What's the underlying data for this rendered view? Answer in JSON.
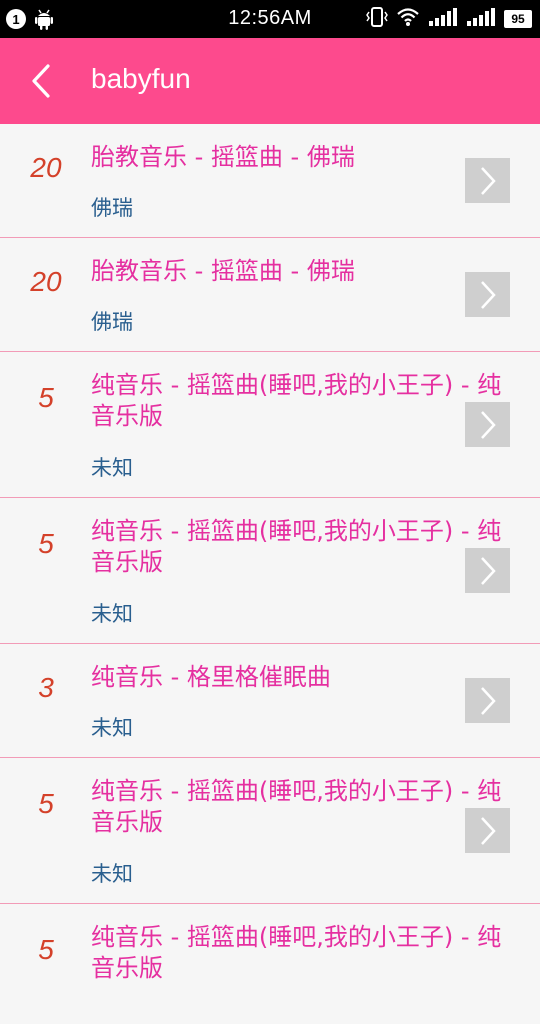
{
  "status_bar": {
    "notification_count": "1",
    "time": "12:56AM",
    "battery": "95"
  },
  "header": {
    "title": "babyfun"
  },
  "colors": {
    "accent": "#fd4a8d",
    "title_text": "#e52fa0",
    "count_text": "#d4412a",
    "artist_text": "#2a5f8f"
  },
  "list": [
    {
      "count": "20",
      "title": "胎教音乐 - 摇篮曲 - 佛瑞",
      "artist": "佛瑞"
    },
    {
      "count": "20",
      "title": "胎教音乐 - 摇篮曲 - 佛瑞",
      "artist": "佛瑞"
    },
    {
      "count": "5",
      "title": "纯音乐 - 摇篮曲(睡吧,我的小王子) - 纯音乐版",
      "artist": "未知"
    },
    {
      "count": "5",
      "title": "纯音乐 - 摇篮曲(睡吧,我的小王子) - 纯音乐版",
      "artist": "未知"
    },
    {
      "count": "3",
      "title": "纯音乐 - 格里格催眠曲",
      "artist": "未知"
    },
    {
      "count": "5",
      "title": "纯音乐 - 摇篮曲(睡吧,我的小王子) - 纯音乐版",
      "artist": "未知"
    },
    {
      "count": "5",
      "title": "纯音乐 - 摇篮曲(睡吧,我的小王子) - 纯音乐版",
      "artist": ""
    }
  ]
}
